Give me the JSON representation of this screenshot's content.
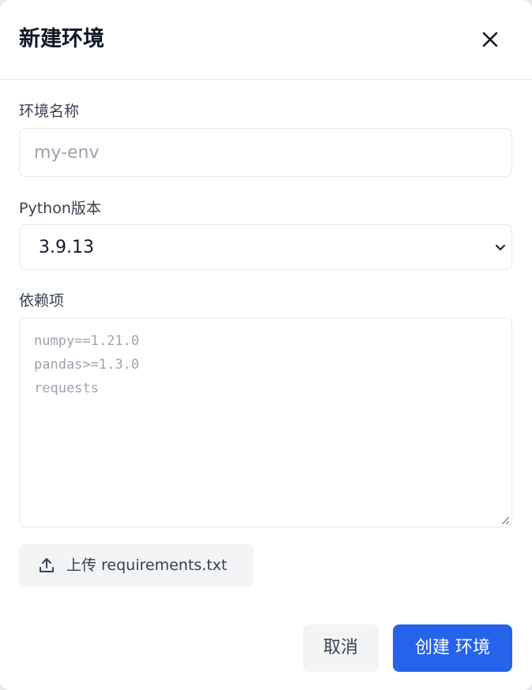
{
  "dialog": {
    "title": "新建环境",
    "close_icon": "close-icon"
  },
  "form": {
    "name_label": "环境名称",
    "name_placeholder": "my-env",
    "name_value": "",
    "python_label": "Python版本",
    "python_selected": "3.9.13",
    "deps_label": "依赖项",
    "deps_placeholder_lines": [
      "numpy==1.21.0",
      "pandas>=1.3.0",
      "requests"
    ]
  },
  "upload": {
    "icon": "upload-icon",
    "label": "上传 requirements.txt"
  },
  "actions": {
    "cancel_label": "取消",
    "create_label": "创建 环境"
  },
  "colors": {
    "primary": "#2563eb",
    "secondary_bg": "#f3f4f6",
    "border": "#e5e7eb",
    "placeholder": "#9ca3af"
  }
}
